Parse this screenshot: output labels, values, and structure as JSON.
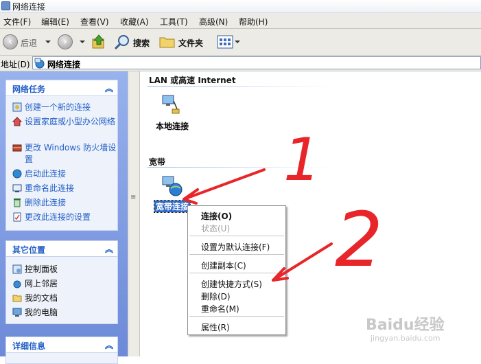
{
  "window": {
    "title": "网络连接"
  },
  "menu": [
    {
      "label": "文件(F)"
    },
    {
      "label": "编辑(E)"
    },
    {
      "label": "查看(V)"
    },
    {
      "label": "收藏(A)"
    },
    {
      "label": "工具(T)"
    },
    {
      "label": "高级(N)"
    },
    {
      "label": "帮助(H)"
    }
  ],
  "toolbar": {
    "back_label": "后退",
    "search_label": "搜索",
    "folders_label": "文件夹"
  },
  "address": {
    "label": "地址(D)",
    "value": "网络连接"
  },
  "left_panel": {
    "network_tasks": {
      "title": "网络任务",
      "items": [
        {
          "label": "创建一个新的连接"
        },
        {
          "label": "设置家庭或小型办公网络"
        },
        {
          "label": "更改 Windows 防火墙设置"
        },
        {
          "label": "启动此连接"
        },
        {
          "label": "重命名此连接"
        },
        {
          "label": "删除此连接"
        },
        {
          "label": "更改此连接的设置"
        }
      ]
    },
    "other_places": {
      "title": "其它位置",
      "items": [
        {
          "label": "控制面板"
        },
        {
          "label": "网上邻居"
        },
        {
          "label": "我的文档"
        },
        {
          "label": "我的电脑"
        }
      ]
    },
    "details": {
      "title": "详细信息"
    }
  },
  "content": {
    "lan_group": "LAN 或高速 Internet",
    "local_connection": "本地连接",
    "broadband_group": "宽带",
    "broadband_connection": "宽带连接"
  },
  "context_menu": {
    "connect": "连接(O)",
    "status": "状态(U)",
    "set_default": "设置为默认连接(F)",
    "create_copy": "创建副本(C)",
    "create_shortcut": "创建快捷方式(S)",
    "delete": "删除(D)",
    "rename": "重命名(M)",
    "properties": "属性(R)"
  },
  "annotations": {
    "one": "1",
    "two": "2",
    "color": "#e8262a"
  },
  "watermark": {
    "brand": "Baidu经验",
    "url": "jingyan.baidu.com"
  }
}
